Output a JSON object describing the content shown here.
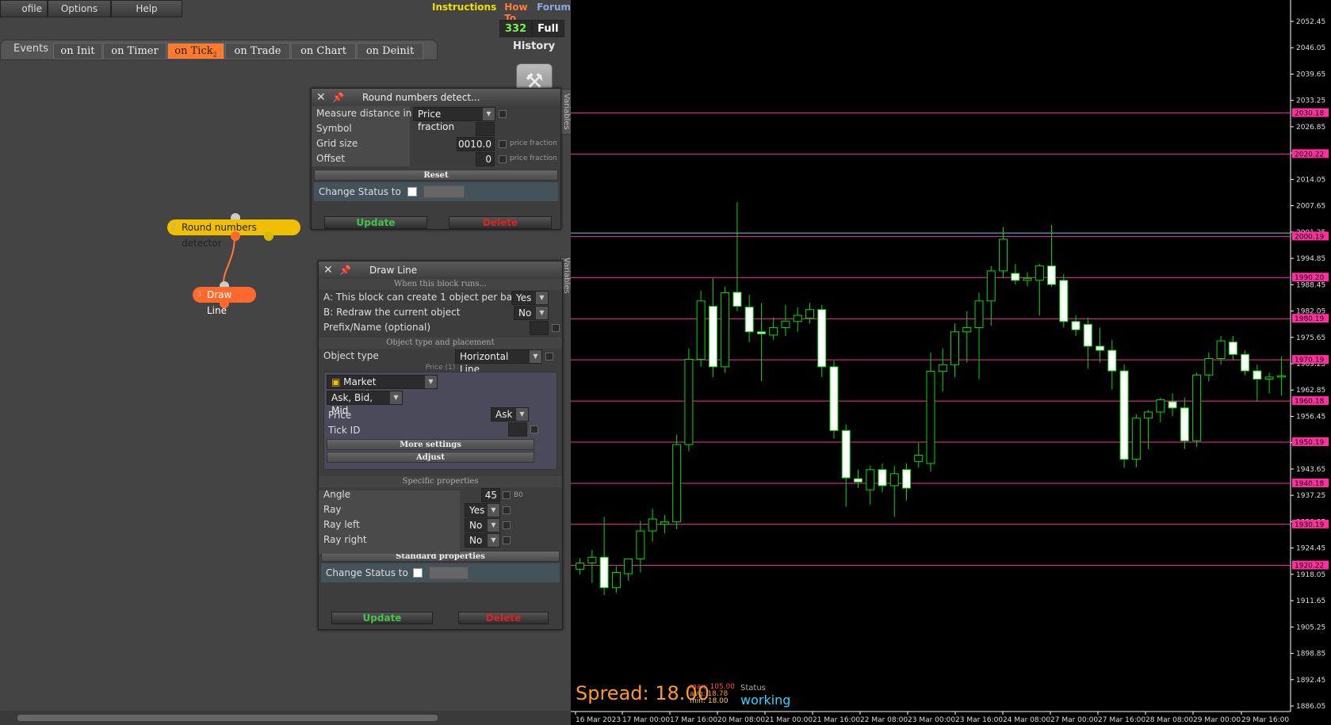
{
  "menu": {
    "profile": "ofile",
    "options": "Options",
    "help": "Help"
  },
  "links": {
    "instructions": "Instructions",
    "howto": "How To",
    "forum": "Forum"
  },
  "counter": {
    "value": "332",
    "full": "Full",
    "history": "History"
  },
  "events": {
    "label": "Events",
    "tabs": [
      "on Init",
      "on Timer",
      "on Tick",
      "on Trade",
      "on Chart",
      "on Deinit"
    ],
    "active": "on Tick",
    "active_sub": "2"
  },
  "side_tab": "Variables",
  "nodes": [
    {
      "index": "2",
      "label": "Round numbers detector"
    },
    {
      "index": "3",
      "label": "Draw Line"
    }
  ],
  "panel_round": {
    "title": "Round numbers detect...",
    "measure_label": "Measure distance in",
    "measure_value": "Price fraction",
    "symbol_label": "Symbol",
    "grid_label": "Grid size",
    "grid_value": "0010.0",
    "grid_hint": "price fraction",
    "offset_label": "Offset",
    "offset_value": "0",
    "offset_hint": "price fraction",
    "reset": "Reset",
    "status_label": "Change Status to",
    "update": "Update",
    "delete": "Delete"
  },
  "panel_draw": {
    "title": "Draw Line",
    "sect_runs": "When this block runs...",
    "a_label": "A: This block can create 1 object per bar",
    "a_value": "Yes",
    "b_label": "B: Redraw the current object",
    "b_value": "No",
    "prefix_label": "Prefix/Name (optional)",
    "sect_obj": "Object type and placement",
    "objtype_label": "Object type",
    "objtype_value": "Horizontal Line",
    "price_caption": "Price (1)",
    "market": "Market properties",
    "askbid": "Ask, Bid, Mid",
    "price_label": "Price",
    "price_value": "Ask",
    "tickid_label": "Tick ID",
    "more": "More settings",
    "adjust": "Adjust",
    "sect_specific": "Specific properties",
    "angle_label": "Angle",
    "angle_value": "45",
    "angle_hint": "B0",
    "ray_label": "Ray",
    "ray_value": "Yes",
    "rayleft_label": "Ray left",
    "rayleft_value": "No",
    "rayright_label": "Ray right",
    "rayright_value": "No",
    "sect_standard": "Standard properties",
    "status_label": "Change Status to",
    "update": "Update",
    "delete": "Delete"
  },
  "chart": {
    "spread_text": "Spread: 18.00",
    "max_text": "max: 105.00",
    "avg_text": "avg: 18.78",
    "min_text": "min: 18.00",
    "status_label": "Status",
    "status_value": "working",
    "colors": {
      "bull": "#00dd00",
      "bear_body": "#ffffff",
      "hline": "#ff2fa0",
      "cyanline": "#5fd0ff"
    }
  },
  "chart_data": {
    "type": "candlestick",
    "price_ticks": [
      "2052.45",
      "2046.05",
      "2039.65",
      "2033.25",
      "2026.85",
      "2020.45",
      "2014.05",
      "2007.65",
      "2001.25",
      "1994.85",
      "1988.45",
      "1982.05",
      "1975.65",
      "1969.25",
      "1962.85",
      "1956.45",
      "1950.05",
      "1943.65",
      "1937.25",
      "1930.85",
      "1924.45",
      "1918.05",
      "1911.65",
      "1905.25",
      "1898.85",
      "1892.45",
      "1886.05"
    ],
    "ylim": [
      1881.6,
      2056.6
    ],
    "hlines": [
      {
        "price": 2030.18,
        "label": "2030.18"
      },
      {
        "price": 2020.22,
        "label": "2020.22"
      },
      {
        "price": 2000.19,
        "label": "2000.19"
      },
      {
        "price": 1990.2,
        "label": "1990.20"
      },
      {
        "price": 1980.19,
        "label": "1980.19"
      },
      {
        "price": 1970.19,
        "label": "1970.19"
      },
      {
        "price": 1960.18,
        "label": "1960.18"
      },
      {
        "price": 1950.19,
        "label": "1950.19"
      },
      {
        "price": 1940.18,
        "label": "1940.18"
      },
      {
        "price": 1930.19,
        "label": "1930.19"
      },
      {
        "price": 1920.22,
        "label": "1920.22"
      }
    ],
    "ask_line": {
      "price": 2001.0
    },
    "x_labels": [
      "16 Mar 2023",
      "17 Mar 00:00",
      "17 Mar 16:00",
      "20 Mar 08:00",
      "21 Mar 00:00",
      "21 Mar 16:00",
      "22 Mar 08:00",
      "23 Mar 00:00",
      "23 Mar 16:00",
      "24 Mar 08:00",
      "27 Mar 00:00",
      "27 Mar 16:00",
      "28 Mar 08:00",
      "29 Mar 00:00",
      "29 Mar 16:00"
    ],
    "candles": [
      {
        "o": 1919.3,
        "h": 1922.0,
        "l": 1918.0,
        "c": 1920.8
      },
      {
        "o": 1920.8,
        "h": 1924.0,
        "l": 1916.0,
        "c": 1922.2
      },
      {
        "o": 1922.2,
        "h": 1932.0,
        "l": 1913.0,
        "c": 1914.8
      },
      {
        "o": 1914.8,
        "h": 1920.0,
        "l": 1913.5,
        "c": 1918.5
      },
      {
        "o": 1918.2,
        "h": 1921.5,
        "l": 1916.5,
        "c": 1921.8
      },
      {
        "o": 1921.8,
        "h": 1931.0,
        "l": 1918.5,
        "c": 1928.6
      },
      {
        "o": 1928.6,
        "h": 1934.0,
        "l": 1926.0,
        "c": 1931.5
      },
      {
        "o": 1930.2,
        "h": 1932.5,
        "l": 1928.0,
        "c": 1930.8
      },
      {
        "o": 1930.8,
        "h": 1952.0,
        "l": 1929.0,
        "c": 1949.6
      },
      {
        "o": 1949.6,
        "h": 1973.0,
        "l": 1948.0,
        "c": 1970.3
      },
      {
        "o": 1970.3,
        "h": 1987.0,
        "l": 1968.5,
        "c": 1984.5
      },
      {
        "o": 1983.2,
        "h": 1990.0,
        "l": 1966.0,
        "c": 1968.5
      },
      {
        "o": 1968.5,
        "h": 1988.0,
        "l": 1967.0,
        "c": 1986.5
      },
      {
        "o": 1986.6,
        "h": 2008.5,
        "l": 1982.0,
        "c": 1983.2
      },
      {
        "o": 1983.0,
        "h": 1986.0,
        "l": 1974.5,
        "c": 1977.0
      },
      {
        "o": 1977.0,
        "h": 1984.0,
        "l": 1965.0,
        "c": 1976.5
      },
      {
        "o": 1976.2,
        "h": 1980.5,
        "l": 1975.0,
        "c": 1978.0
      },
      {
        "o": 1978.0,
        "h": 1983.5,
        "l": 1976.0,
        "c": 1979.6
      },
      {
        "o": 1979.5,
        "h": 1983.0,
        "l": 1977.0,
        "c": 1981.0
      },
      {
        "o": 1980.3,
        "h": 1984.0,
        "l": 1979.0,
        "c": 1982.4
      },
      {
        "o": 1982.4,
        "h": 1983.5,
        "l": 1966.0,
        "c": 1968.5
      },
      {
        "o": 1968.5,
        "h": 1970.0,
        "l": 1951.0,
        "c": 1953.0
      },
      {
        "o": 1953.0,
        "h": 1954.5,
        "l": 1934.5,
        "c": 1941.5
      },
      {
        "o": 1941.3,
        "h": 1943.5,
        "l": 1939.0,
        "c": 1940.5
      },
      {
        "o": 1938.6,
        "h": 1944.5,
        "l": 1935.0,
        "c": 1943.5
      },
      {
        "o": 1943.5,
        "h": 1945.0,
        "l": 1938.0,
        "c": 1939.6
      },
      {
        "o": 1939.6,
        "h": 1944.5,
        "l": 1932.0,
        "c": 1942.5
      },
      {
        "o": 1943.5,
        "h": 1945.0,
        "l": 1936.0,
        "c": 1939.0
      },
      {
        "o": 1945.5,
        "h": 1950.0,
        "l": 1944.0,
        "c": 1947.0
      },
      {
        "o": 1945.0,
        "h": 1972.0,
        "l": 1943.0,
        "c": 1967.4
      },
      {
        "o": 1967.4,
        "h": 1973.0,
        "l": 1962.5,
        "c": 1969.0
      },
      {
        "o": 1969.0,
        "h": 1979.0,
        "l": 1966.0,
        "c": 1977.0
      },
      {
        "o": 1977.0,
        "h": 1982.0,
        "l": 1969.5,
        "c": 1978.0
      },
      {
        "o": 1978.0,
        "h": 1986.5,
        "l": 1965.5,
        "c": 1984.5
      },
      {
        "o": 1984.5,
        "h": 1993.0,
        "l": 1978.5,
        "c": 1991.8
      },
      {
        "o": 1991.8,
        "h": 2002.5,
        "l": 1990.0,
        "c": 1999.5
      },
      {
        "o": 1991.2,
        "h": 1993.5,
        "l": 1988.5,
        "c": 1989.5
      },
      {
        "o": 1989.5,
        "h": 1991.5,
        "l": 1988.0,
        "c": 1990.0
      },
      {
        "o": 1989.5,
        "h": 1993.5,
        "l": 1981.0,
        "c": 1993.0
      },
      {
        "o": 1993.0,
        "h": 2003.0,
        "l": 1988.0,
        "c": 1988.5
      },
      {
        "o": 1989.5,
        "h": 1991.0,
        "l": 1978.0,
        "c": 1979.5
      },
      {
        "o": 1979.5,
        "h": 1981.0,
        "l": 1976.0,
        "c": 1977.5
      },
      {
        "o": 1978.8,
        "h": 1980.5,
        "l": 1968.0,
        "c": 1973.5
      },
      {
        "o": 1973.5,
        "h": 1978.0,
        "l": 1969.5,
        "c": 1972.5
      },
      {
        "o": 1972.5,
        "h": 1975.0,
        "l": 1963.0,
        "c": 1967.5
      },
      {
        "o": 1967.5,
        "h": 1969.0,
        "l": 1944.0,
        "c": 1946.0
      },
      {
        "o": 1946.0,
        "h": 1957.0,
        "l": 1944.0,
        "c": 1956.0
      },
      {
        "o": 1956.0,
        "h": 1958.0,
        "l": 1948.5,
        "c": 1957.5
      },
      {
        "o": 1957.5,
        "h": 1961.0,
        "l": 1955.0,
        "c": 1960.5
      },
      {
        "o": 1960.0,
        "h": 1962.0,
        "l": 1956.5,
        "c": 1958.5
      },
      {
        "o": 1958.5,
        "h": 1961.0,
        "l": 1948.5,
        "c": 1950.5
      },
      {
        "o": 1950.5,
        "h": 1967.0,
        "l": 1949.0,
        "c": 1966.5
      },
      {
        "o": 1966.5,
        "h": 1972.0,
        "l": 1965.0,
        "c": 1970.5
      },
      {
        "o": 1970.5,
        "h": 1976.0,
        "l": 1969.0,
        "c": 1974.8
      },
      {
        "o": 1974.5,
        "h": 1976.0,
        "l": 1970.0,
        "c": 1971.5
      },
      {
        "o": 1971.5,
        "h": 1972.5,
        "l": 1966.5,
        "c": 1967.5
      },
      {
        "o": 1967.5,
        "h": 1969.0,
        "l": 1960.0,
        "c": 1965.5
      },
      {
        "o": 1965.5,
        "h": 1967.0,
        "l": 1962.0,
        "c": 1966.0
      },
      {
        "o": 1966.0,
        "h": 1971.0,
        "l": 1961.5,
        "c": 1966.3
      }
    ]
  }
}
